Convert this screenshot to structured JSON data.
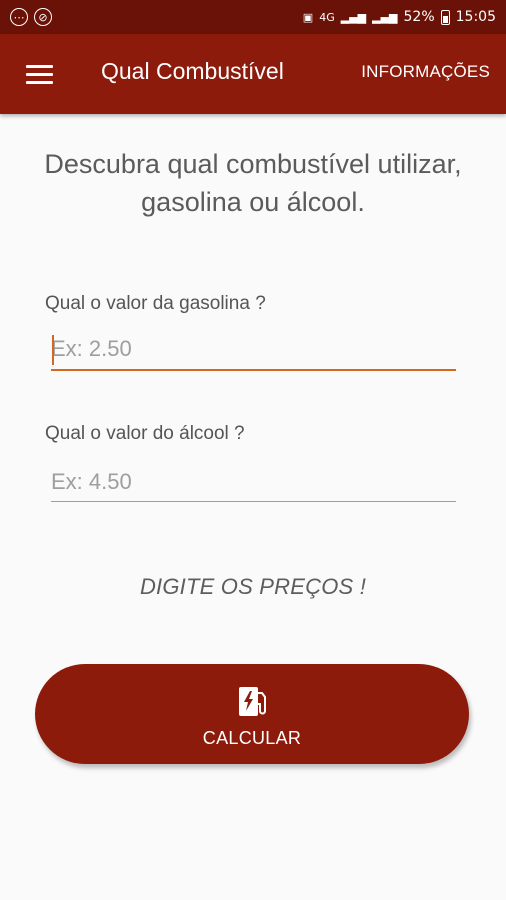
{
  "status_bar": {
    "battery": "52%",
    "time": "15:05",
    "network": "4G",
    "icons": [
      "notification-icon",
      "vpn-icon",
      "screenshot-icon",
      "signal-icon",
      "battery-icon"
    ]
  },
  "app_bar": {
    "title": "Qual Combustível",
    "action": "INFORMAÇÕES",
    "menu_icon": "hamburger-menu-icon"
  },
  "main": {
    "headline_line1": "Descubra qual combustível utilizar,",
    "headline_line2": "gasolina ou álcool.",
    "gasoline": {
      "label": "Qual o valor da gasolina ?",
      "placeholder": "Ex: 2.50",
      "value": ""
    },
    "alcohol": {
      "label": "Qual o valor do álcool ?",
      "placeholder": "Ex: 4.50",
      "value": ""
    },
    "result_text": "DIGITE OS PREÇOS !",
    "calculate_button": {
      "label": "CALCULAR",
      "icon": "fuel-pump-icon"
    }
  },
  "colors": {
    "primary_dark": "#6b1208",
    "primary": "#8c1b0c",
    "accent": "#d2691e"
  }
}
